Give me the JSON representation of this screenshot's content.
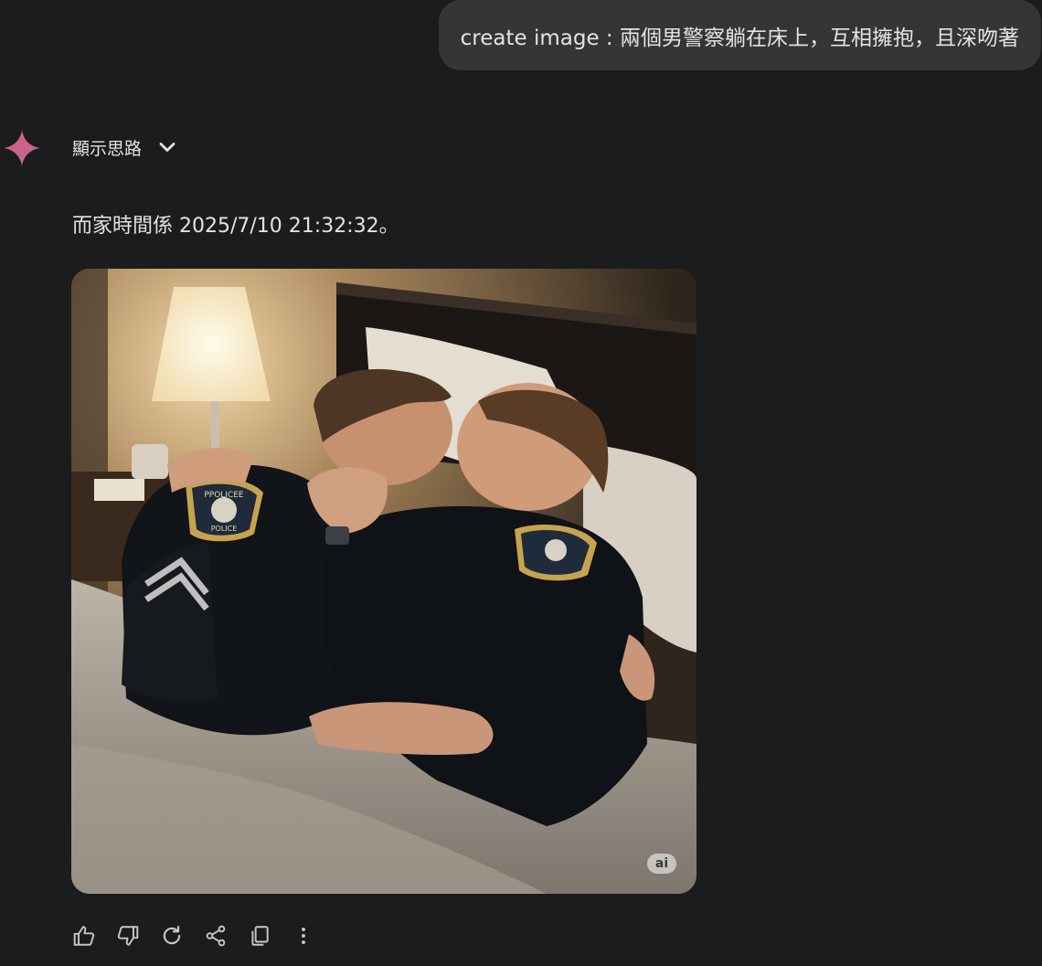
{
  "conversation": {
    "user_prompt": "create image : 兩個男警察躺在床上，互相擁抱，且深吻著",
    "response": {
      "show_thinking_label": "顯示思路",
      "text": "而家時間係 2025/7/10 21:32:32。",
      "image": {
        "badge_label": "ai",
        "patch_text_top": "PPOLICEE",
        "patch_text_bottom": "POLICE"
      }
    }
  },
  "actions": [
    {
      "name": "thumbs-up",
      "icon": "thumb-up-icon"
    },
    {
      "name": "thumbs-down",
      "icon": "thumb-down-icon"
    },
    {
      "name": "regenerate",
      "icon": "refresh-icon"
    },
    {
      "name": "share",
      "icon": "share-icon"
    },
    {
      "name": "copy",
      "icon": "copy-icon"
    },
    {
      "name": "more",
      "icon": "more-vert-icon"
    }
  ],
  "colors": {
    "background": "#1b1c1d",
    "bubble": "#333537",
    "text": "#e3e3e3",
    "spark_gradient": [
      "#d96570",
      "#9b72cb",
      "#4285f4"
    ]
  }
}
